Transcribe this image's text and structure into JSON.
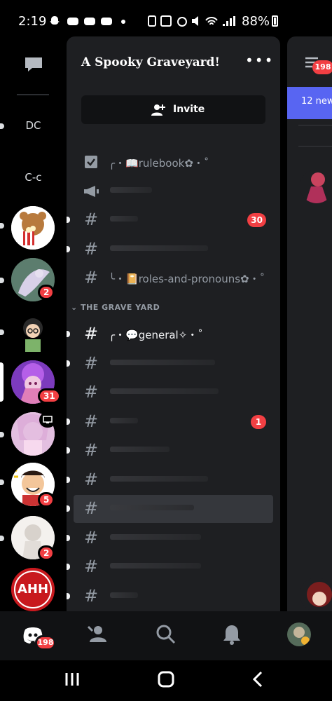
{
  "status_bar": {
    "time": "2:19",
    "battery_percent": "88%",
    "left_icons": [
      "snapchat-icon",
      "discord-icon",
      "discord-icon",
      "discord-icon",
      "dot-icon"
    ],
    "right_icons": [
      "data-saver-icon",
      "nfc-icon",
      "alarm-icon",
      "mute-icon",
      "wifi-icon",
      "signal-icon",
      "battery-icon"
    ]
  },
  "server_rail": {
    "text_servers": [
      "DC",
      "C-c"
    ],
    "server_badges": [
      "2",
      "31",
      "5",
      "2"
    ],
    "last_server_label": "AHH"
  },
  "server": {
    "name": "A Spooky Graveyard!",
    "invite_label": "Invite",
    "more_icon": "more-icon"
  },
  "channels": {
    "top": [
      {
        "icon": "rules-icon",
        "name": "╭・📖rulebook✿・˚",
        "badge": ""
      },
      {
        "icon": "announcement-icon",
        "name": "",
        "badge": ""
      },
      {
        "icon": "hash-icon",
        "name": "",
        "badge": "30"
      },
      {
        "icon": "hash-icon",
        "name": "",
        "badge": ""
      },
      {
        "icon": "hash-icon",
        "name": "╰・📔roles-and-pronouns✿・˚",
        "badge": ""
      }
    ],
    "category": "THE GRAVE YARD",
    "grave": [
      {
        "name": "╭・💬general✧・˚",
        "badge": ""
      },
      {
        "name": "",
        "badge": ""
      },
      {
        "name": "",
        "badge": ""
      },
      {
        "name": "",
        "badge": "1"
      },
      {
        "name": "",
        "badge": ""
      },
      {
        "name": "",
        "badge": ""
      },
      {
        "name": "",
        "badge": ""
      },
      {
        "name": "",
        "badge": ""
      },
      {
        "name": "",
        "badge": ""
      },
      {
        "name": "",
        "badge": ""
      }
    ]
  },
  "peek": {
    "badge": "198",
    "banner": "12 new"
  },
  "bottom_nav": {
    "home_badge": "198"
  },
  "colors": {
    "panel_bg": "#1e1f22",
    "badge_red": "#f23f43",
    "blurple": "#5865f2",
    "muted_text": "#949ba4"
  }
}
